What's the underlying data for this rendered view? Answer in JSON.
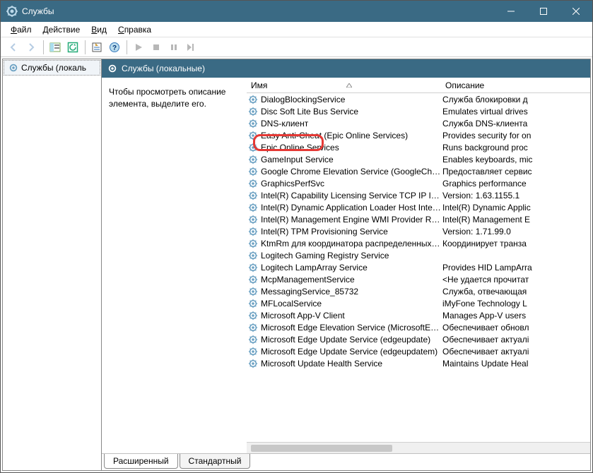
{
  "window": {
    "title": "Службы"
  },
  "menu": {
    "file": "Файл",
    "action": "Действие",
    "view": "Вид",
    "help": "Справка"
  },
  "tree": {
    "item": "Службы (локаль"
  },
  "pane": {
    "header": "Службы (локальные)"
  },
  "detail": {
    "hint": "Чтобы просмотреть описание элемента, выделите его."
  },
  "columns": {
    "name": "Имя",
    "desc": "Описание"
  },
  "tabs": {
    "extended": "Расширенный",
    "standard": "Стандартный"
  },
  "services": [
    {
      "name": "DialogBlockingService",
      "desc": "Служба блокировки д"
    },
    {
      "name": "Disc Soft Lite Bus Service",
      "desc": "Emulates virtual drives"
    },
    {
      "name": "DNS-клиент",
      "desc": "Служба DNS-клиента"
    },
    {
      "name": "Easy Anti-Cheat (Epic Online Services)",
      "desc": "Provides security for on"
    },
    {
      "name": "Epic Online Services",
      "desc": "Runs background proc"
    },
    {
      "name": "GameInput Service",
      "desc": "Enables keyboards, mic"
    },
    {
      "name": "Google Chrome Elevation Service (GoogleChromeElev...",
      "desc": "Предоставляет сервис"
    },
    {
      "name": "GraphicsPerfSvc",
      "desc": "Graphics performance"
    },
    {
      "name": "Intel(R) Capability Licensing Service TCP IP Interface",
      "desc": "Version: 1.63.1155.1"
    },
    {
      "name": "Intel(R) Dynamic Application Loader Host Interface Ser...",
      "desc": "Intel(R) Dynamic Applic"
    },
    {
      "name": "Intel(R) Management Engine WMI Provider Registration",
      "desc": "Intel(R) Management E"
    },
    {
      "name": "Intel(R) TPM Provisioning Service",
      "desc": "Version: 1.71.99.0"
    },
    {
      "name": "KtmRm для координатора распределенных транзак...",
      "desc": "Координирует транза"
    },
    {
      "name": "Logitech Gaming Registry Service",
      "desc": ""
    },
    {
      "name": "Logitech LampArray Service",
      "desc": "Provides HID LampArra"
    },
    {
      "name": "McpManagementService",
      "desc": "<Не удается прочитат"
    },
    {
      "name": "MessagingService_85732",
      "desc": "Служба, отвечающая"
    },
    {
      "name": "MFLocalService",
      "desc": "iMyFone Technology L"
    },
    {
      "name": "Microsoft App-V Client",
      "desc": "Manages App-V users"
    },
    {
      "name": "Microsoft Edge Elevation Service (MicrosoftEdgeElevati...",
      "desc": "Обеспечивает обновл"
    },
    {
      "name": "Microsoft Edge Update Service (edgeupdate)",
      "desc": "Обеспечивает актуалі"
    },
    {
      "name": "Microsoft Edge Update Service (edgeupdatem)",
      "desc": "Обеспечивает актуалі"
    },
    {
      "name": "Microsoft Update Health Service",
      "desc": "Maintains Update Heal"
    }
  ]
}
